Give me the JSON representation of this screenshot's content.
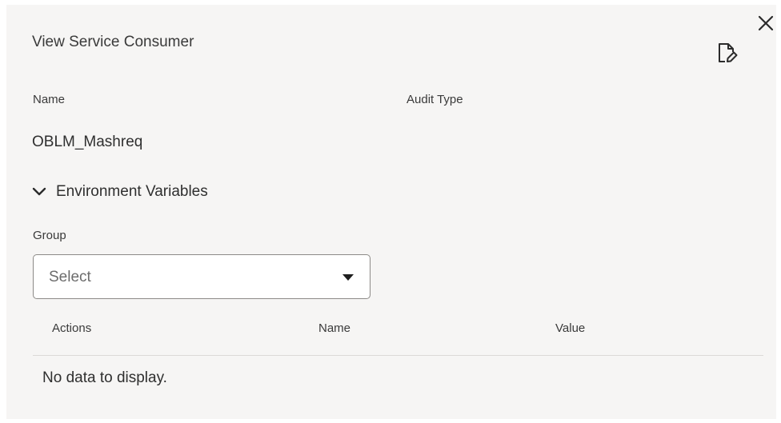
{
  "dialog": {
    "title": "View Service Consumer",
    "close_icon": "close-icon",
    "edit_icon": "document-edit-icon"
  },
  "details": {
    "name_label": "Name",
    "audit_type_label": "Audit Type",
    "name_value": "OBLM_Mashreq",
    "audit_type_value": ""
  },
  "environment_variables": {
    "section_label": "Environment Variables",
    "expanded": true,
    "group_label": "Group",
    "group_select": {
      "placeholder": "Select"
    },
    "table": {
      "columns": [
        "Actions",
        "Name",
        "Value"
      ],
      "rows": [],
      "empty_message": "No data to display."
    }
  },
  "colors": {
    "panel_background": "#f6f5f4",
    "border": "#8c8a87",
    "text": "#2f2f2f"
  }
}
